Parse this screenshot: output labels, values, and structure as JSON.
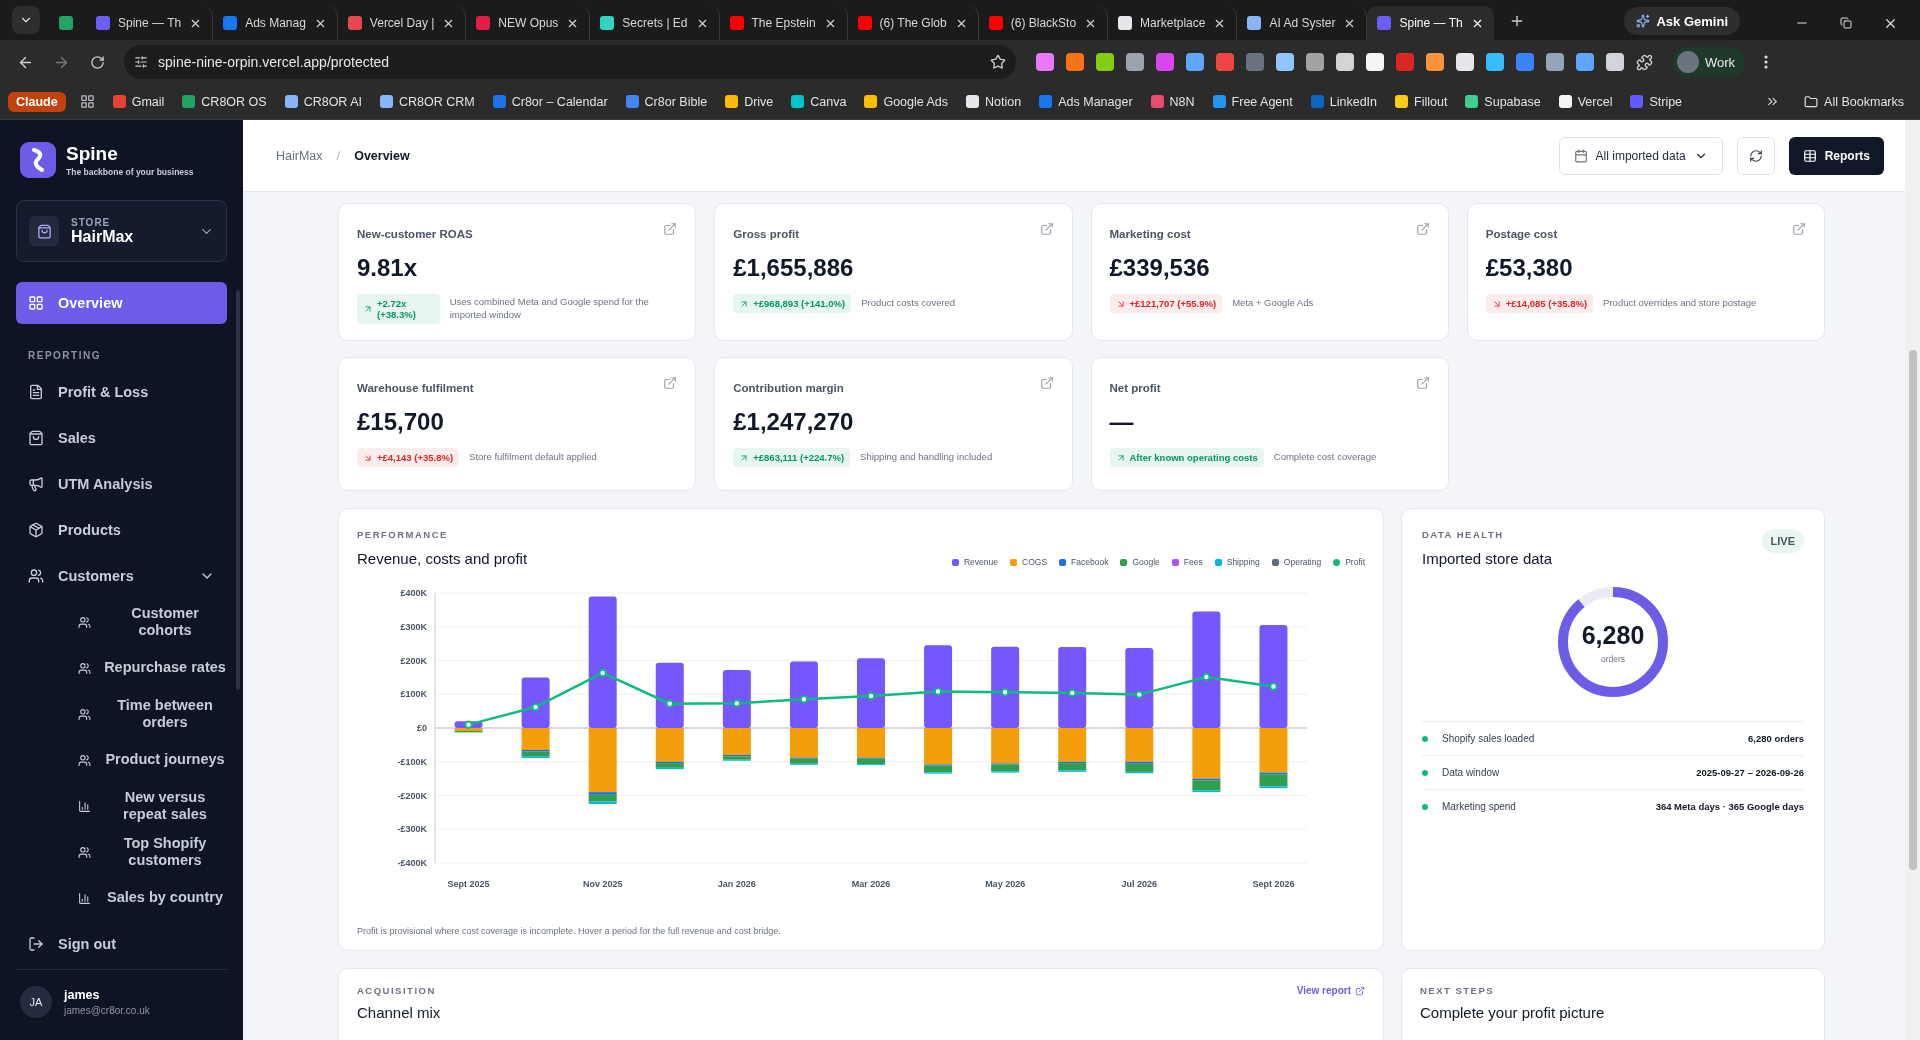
{
  "browser": {
    "tabs": [
      {
        "color": "#1fa463",
        "selected": false
      },
      {
        "title": "Spine — Th",
        "color": "#6d5cf6",
        "selected": false
      },
      {
        "title": "Ads Manag",
        "color": "#1877f2",
        "selected": false
      },
      {
        "title": "Vercel Day |",
        "color": "#e5484d",
        "selected": false
      },
      {
        "title": "NEW Opus",
        "color": "#e11d48",
        "selected": false
      },
      {
        "title": "Secrets | Ed",
        "color": "#2dd4bf",
        "selected": false
      },
      {
        "title": "The Epstein",
        "color": "#ff0000",
        "selected": false
      },
      {
        "title": "(6) The Glob",
        "color": "#ff0000",
        "selected": false
      },
      {
        "title": "(6) BlackSto",
        "color": "#ff0000",
        "selected": false
      },
      {
        "title": "Marketplace",
        "color": "#e5e7eb",
        "selected": false
      },
      {
        "title": "AI Ad Syster",
        "color": "#8ab4f8",
        "selected": false
      },
      {
        "title": "Spine — Th",
        "color": "#6d5cf6",
        "selected": true
      }
    ],
    "gemini": "Ask Gemini",
    "address": "spine-nine-orpin.vercel.app/protected",
    "profile": "Work",
    "bookmarks": [
      {
        "kind": "pill",
        "label": "Claude",
        "color": "#c2410c"
      },
      {
        "kind": "apps"
      },
      {
        "kind": "link",
        "label": "Gmail",
        "color": "#ea4335"
      },
      {
        "kind": "link",
        "label": "CR8OR OS",
        "color": "#1fa463"
      },
      {
        "kind": "link",
        "label": "CR8OR AI",
        "color": "#8ab4f8"
      },
      {
        "kind": "link",
        "label": "CR8OR CRM",
        "color": "#8ab4f8"
      },
      {
        "kind": "link",
        "label": "Cr8or – Calendar",
        "color": "#1a73e8"
      },
      {
        "kind": "link",
        "label": "Cr8or Bible",
        "color": "#4285f4"
      },
      {
        "kind": "link",
        "label": "Drive",
        "color": "#fbbc04"
      },
      {
        "kind": "link",
        "label": "Canva",
        "color": "#00c4cc"
      },
      {
        "kind": "link",
        "label": "Google Ads",
        "color": "#fbbc04"
      },
      {
        "kind": "link",
        "label": "Notion",
        "color": "#e5e7eb"
      },
      {
        "kind": "link",
        "label": "Ads Manager",
        "color": "#1877f2"
      },
      {
        "kind": "link",
        "label": "N8N",
        "color": "#ea4b71"
      },
      {
        "kind": "link",
        "label": "Free Agent",
        "color": "#2196f3"
      },
      {
        "kind": "link",
        "label": "LinkedIn",
        "color": "#0a66c2"
      },
      {
        "kind": "link",
        "label": "Fillout",
        "color": "#facc15"
      },
      {
        "kind": "link",
        "label": "Supabase",
        "color": "#3ecf8e"
      },
      {
        "kind": "link",
        "label": "Vercel",
        "color": "#f5f5f5"
      },
      {
        "kind": "link",
        "label": "Stripe",
        "color": "#635bff"
      }
    ],
    "all_bookmarks": "All Bookmarks"
  },
  "sidebar": {
    "brand": "Spine",
    "tagline": "The backbone of your business",
    "store": {
      "label": "STORE",
      "name": "HairMax"
    },
    "nav": [
      {
        "label": "Overview",
        "selected": true
      }
    ],
    "section": "REPORTING",
    "items": [
      {
        "label": "Profit & Loss",
        "selected": false
      },
      {
        "label": "Sales",
        "selected": false
      },
      {
        "label": "UTM Analysis",
        "selected": false
      },
      {
        "label": "Products",
        "selected": false
      },
      {
        "label": "Customers",
        "selected": false,
        "expanded": true,
        "children": [
          {
            "label": "Customer cohorts",
            "selected": false
          },
          {
            "label": "Repurchase rates",
            "selected": false
          },
          {
            "label": "Time between orders",
            "selected": false
          },
          {
            "label": "Product journeys",
            "selected": false
          },
          {
            "label": "New versus repeat sales",
            "selected": false
          },
          {
            "label": "Top Shopify customers",
            "selected": false
          },
          {
            "label": "Sales by country",
            "selected": false
          }
        ]
      }
    ],
    "sign_out": "Sign out",
    "user": {
      "initials": "JA",
      "name": "james",
      "email": "james@cr8or.co.uk"
    }
  },
  "header": {
    "breadcrumb": [
      "HairMax",
      "Overview"
    ],
    "separator": "/",
    "range": "All imported data",
    "reports": "Reports"
  },
  "metrics": [
    {
      "title": "New-customer ROAS",
      "value": "9.81x",
      "delta": "+2.72x (+38.3%)",
      "positive": true,
      "note": "Uses combined Meta and Google spend for the imported window"
    },
    {
      "title": "Gross profit",
      "value": "£1,655,886",
      "delta": "+£968,893 (+141.0%)",
      "positive": true,
      "note": "Product costs covered"
    },
    {
      "title": "Marketing cost",
      "value": "£339,536",
      "delta": "+£121,707 (+55.9%)",
      "positive": false,
      "note": "Meta + Google Ads"
    },
    {
      "title": "Postage cost",
      "value": "£53,380",
      "delta": "+£14,085 (+35.8%)",
      "positive": false,
      "note": "Product overrides and store postage"
    },
    {
      "title": "Warehouse fulfilment",
      "value": "£15,700",
      "delta": "+£4,143 (+35.8%)",
      "positive": false,
      "note": "Store fulfilment default applied"
    },
    {
      "title": "Contribution margin",
      "value": "£1,247,270",
      "delta": "+£863,111 (+224.7%)",
      "positive": true,
      "note": "Shipping and handling included"
    },
    {
      "title": "Net profit",
      "value": "—",
      "delta": "After known operating costs",
      "positive": true,
      "note": "Complete cost coverage"
    }
  ],
  "performance": {
    "eyebrow": "PERFORMANCE",
    "title": "Revenue, costs and profit",
    "chart_data": {
      "type": "bar",
      "stacked": true,
      "grid": true,
      "categories": [
        "Sept 2025",
        null,
        "Nov 2025",
        null,
        "Jan 2026",
        null,
        "Mar 2026",
        null,
        "May 2026",
        null,
        "Jul 2026",
        null,
        "Sept 2026"
      ],
      "ylim": [
        -400000,
        400000
      ],
      "yticks": [
        {
          "value": 400000,
          "label": "£400K"
        },
        {
          "value": 300000,
          "label": "£300K"
        },
        {
          "value": 200000,
          "label": "£200K"
        },
        {
          "value": 100000,
          "label": "£100K"
        },
        {
          "value": 0,
          "label": "£0"
        },
        {
          "value": -100000,
          "label": "-£100K"
        },
        {
          "value": -200000,
          "label": "-£200K"
        },
        {
          "value": -300000,
          "label": "-£300K"
        },
        {
          "value": -400000,
          "label": "-£400K"
        }
      ],
      "series": [
        {
          "name": "Revenue",
          "color": "#7657fd",
          "values": [
            20000,
            150000,
            390000,
            193000,
            172000,
            197000,
            207000,
            245000,
            241000,
            240000,
            237000,
            345000,
            305000
          ]
        },
        {
          "name": "COGS",
          "color": "#f59e0b",
          "values": [
            -9000,
            -65000,
            -190000,
            -100000,
            -80000,
            -88000,
            -88000,
            -108000,
            -105000,
            -100000,
            -100000,
            -150000,
            -132000
          ]
        },
        {
          "name": "Facebook",
          "color": "#1d6fe6",
          "values": [
            0,
            -5000,
            -8000,
            -4000,
            -4000,
            -3000,
            -3000,
            -3000,
            -3000,
            -4000,
            -6000,
            -5000,
            -5000
          ]
        },
        {
          "name": "Google",
          "color": "#2f9e4f",
          "values": [
            -4000,
            -15000,
            -20000,
            -14000,
            -10000,
            -15000,
            -16000,
            -20000,
            -20000,
            -22000,
            -24000,
            -30000,
            -36000
          ]
        },
        {
          "name": "Fees",
          "color": "#a855f7",
          "values": [
            0,
            0,
            0,
            0,
            0,
            0,
            0,
            0,
            0,
            0,
            0,
            0,
            0
          ]
        },
        {
          "name": "Shipping",
          "color": "#06b6d4",
          "values": [
            0,
            -4000,
            -7000,
            -4000,
            -3000,
            -3000,
            -3000,
            -4000,
            -4000,
            -4000,
            -4000,
            -5000,
            -5000
          ]
        },
        {
          "name": "Operating",
          "color": "#5b6b80",
          "values": [
            0,
            0,
            0,
            0,
            0,
            0,
            0,
            0,
            0,
            0,
            0,
            0,
            0
          ]
        },
        {
          "name": "Profit",
          "type": "line",
          "marker": "circle",
          "color": "#10b981",
          "values": [
            10000,
            62000,
            163000,
            72000,
            73000,
            85000,
            95000,
            108000,
            106000,
            104000,
            99000,
            151000,
            123000
          ]
        }
      ]
    },
    "footnote": "Profit is provisional where cost coverage is incomplete. Hover a period for the full revenue and cost bridge."
  },
  "data_health": {
    "eyebrow": "DATA HEALTH",
    "title": "Imported store data",
    "badge": "LIVE",
    "orders": {
      "value": "6,280",
      "unit": "orders",
      "level": 0.89
    },
    "rows": [
      {
        "label": "Shopify sales loaded",
        "value": "6,280 orders",
        "color": "#10b981"
      },
      {
        "label": "Data window",
        "value": "2025-09-27 – 2026-09-26",
        "color": "#10b981"
      },
      {
        "label": "Marketing spend",
        "value": "364 Meta days · 365 Google days",
        "color": "#10b981"
      }
    ]
  },
  "bottom_cards": [
    {
      "eyebrow": "ACQUISITION",
      "title": "Channel mix",
      "link": "View report"
    },
    {
      "eyebrow": "NEXT STEPS",
      "title": "Complete your profit picture"
    }
  ]
}
